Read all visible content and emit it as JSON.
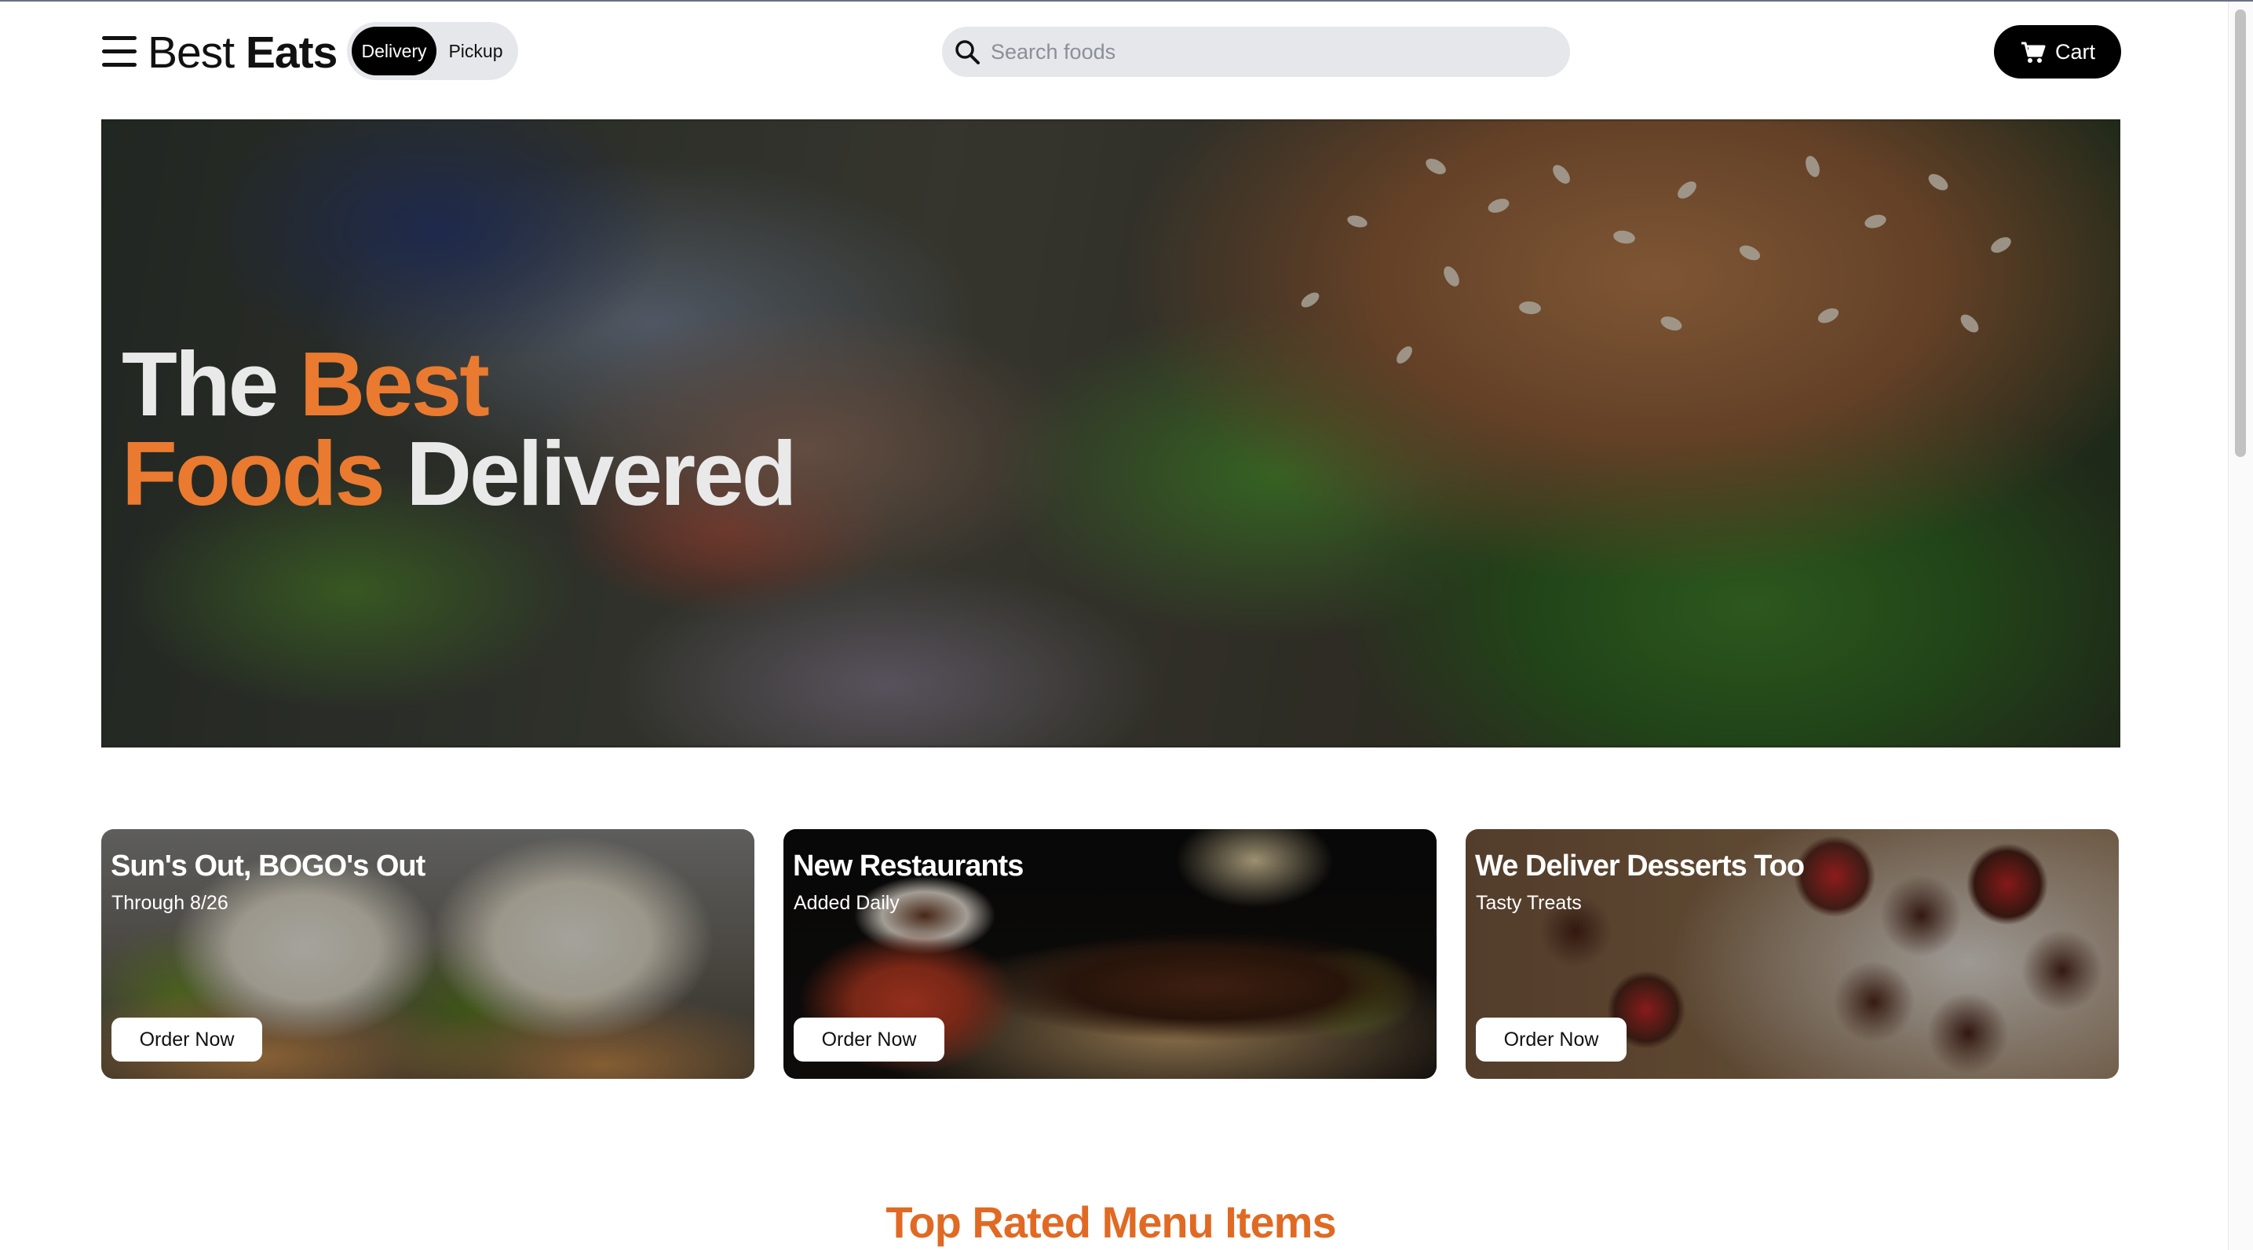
{
  "header": {
    "brand_light": "Best",
    "brand_bold": "Eats",
    "mode_options": [
      "Delivery",
      "Pickup"
    ],
    "search_placeholder": "Search foods",
    "cart_label": "Cart"
  },
  "hero": {
    "line1_white": "The",
    "line1_accent": "Best",
    "line2_accent": "Foods",
    "line2_white": "Delivered"
  },
  "promos": [
    {
      "title": "Sun's Out, BOGO's Out",
      "subtitle": "Through 8/26",
      "button": "Order Now"
    },
    {
      "title": "New Restaurants",
      "subtitle": "Added Daily",
      "button": "Order Now"
    },
    {
      "title": "We Deliver Desserts Too",
      "subtitle": "Tasty Treats",
      "button": "Order Now"
    }
  ],
  "section": {
    "title": "Top Rated Menu Items"
  },
  "colors": {
    "accent": "#ea7a2f",
    "section_title": "#e06a24",
    "header_button": "#000000",
    "search_bg": "#e5e7eb"
  },
  "icons": [
    "hamburger-menu-icon",
    "search-icon",
    "cart-icon"
  ]
}
